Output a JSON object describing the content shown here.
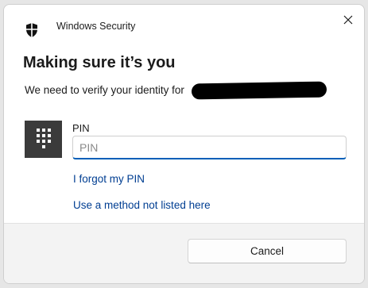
{
  "window": {
    "app_title": "Windows Security",
    "close_icon": "close-icon",
    "shield_icon": "shield-icon"
  },
  "content": {
    "heading": "Making sure it’s you",
    "verify_text": "We need to verify your identity for"
  },
  "pin": {
    "label": "PIN",
    "placeholder": "PIN",
    "value": "",
    "tile_icon": "keypad-icon"
  },
  "links": {
    "forgot_pin": "I forgot my PIN",
    "other_method": "Use a method not listed here"
  },
  "footer": {
    "cancel_label": "Cancel"
  },
  "colors": {
    "accent": "#005fb8",
    "link": "#003e92",
    "tile": "#3b3b3b"
  }
}
